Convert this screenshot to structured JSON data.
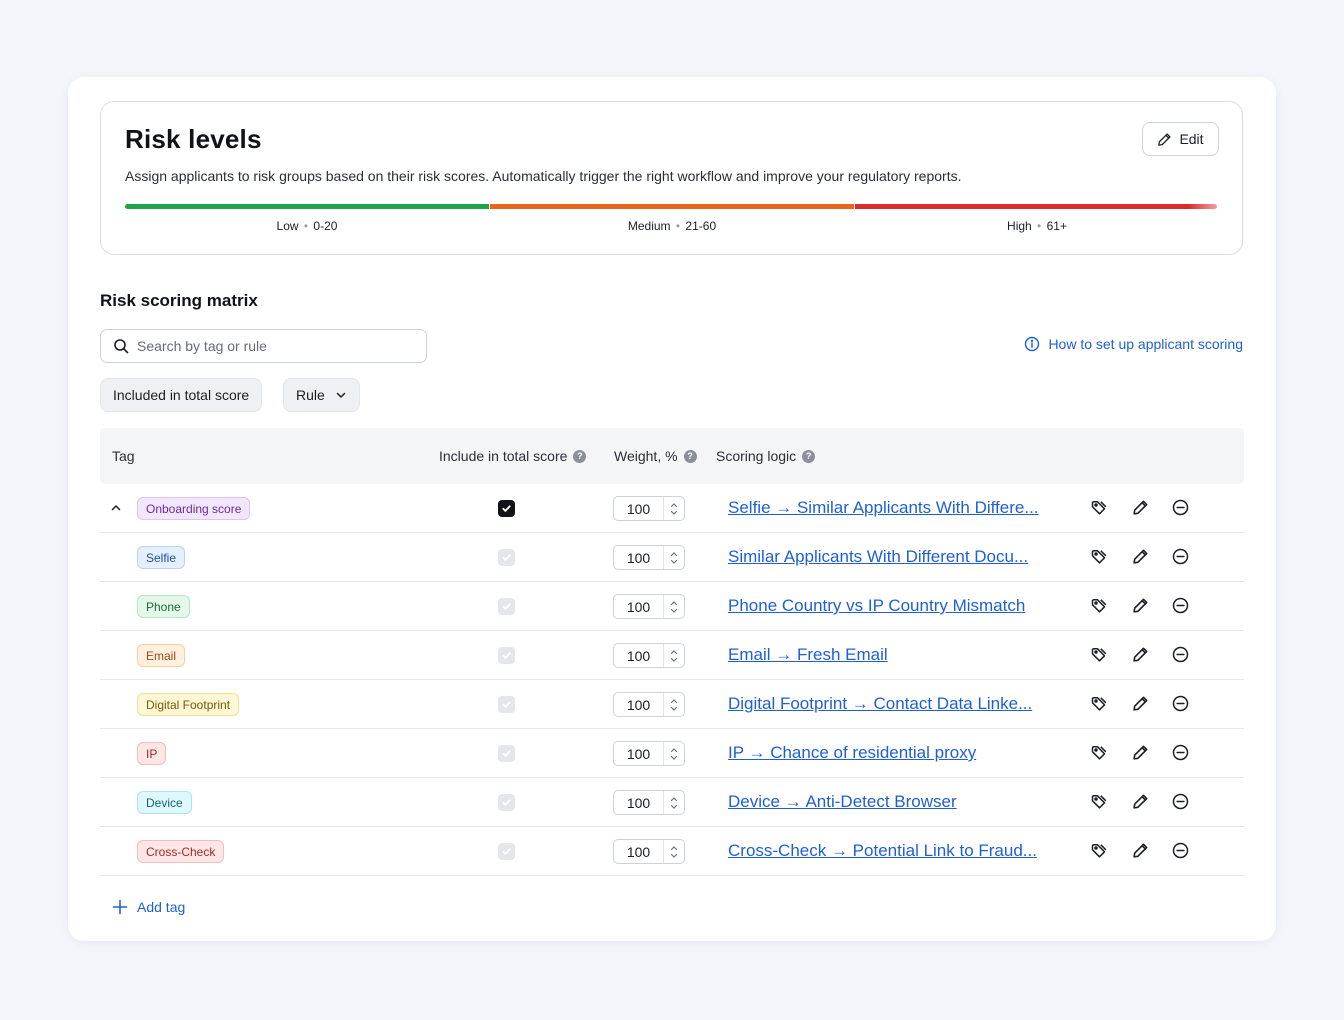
{
  "risk_levels": {
    "title": "Risk levels",
    "description": "Assign applicants to risk groups based on their risk scores. Automatically trigger the right workflow and improve your regulatory reports.",
    "edit_label": "Edit",
    "levels": [
      {
        "name": "Low",
        "range": "0-20",
        "color": "#1fa34a"
      },
      {
        "name": "Medium",
        "range": "21-60",
        "color": "#e9661c"
      },
      {
        "name": "High",
        "range": "61+",
        "color": "#db2b2b"
      }
    ]
  },
  "matrix": {
    "title": "Risk scoring matrix",
    "search_placeholder": "Search by tag or rule",
    "help_link": "How to set up applicant scoring",
    "filters": [
      "Included in total score",
      "Rule"
    ],
    "columns": [
      "Tag",
      "Include in total score",
      "Weight, %",
      "Scoring logic"
    ],
    "rows": [
      {
        "tag": "Onboarding score",
        "included": true,
        "weight": "100",
        "logic": "Selfie → Similar Applicants With Differe...",
        "tag_bg": "#f2e6fb",
        "tag_border": "#ddc2f2",
        "tag_color": "#6b2a9c"
      },
      {
        "tag": "Selfie",
        "included": true,
        "weight": "100",
        "logic": "Similar Applicants With Different Docu...",
        "tag_bg": "#e4efff",
        "tag_border": "#b9d3f8",
        "tag_color": "#1d4f9a"
      },
      {
        "tag": "Phone",
        "included": true,
        "weight": "100",
        "logic": "Phone Country vs IP Country Mismatch",
        "tag_bg": "#e4f8ea",
        "tag_border": "#b4e6c3",
        "tag_color": "#1c6b36"
      },
      {
        "tag": "Email",
        "included": true,
        "weight": "100",
        "logic": "Email → Fresh Email",
        "tag_bg": "#fff0df",
        "tag_border": "#f6cfa0",
        "tag_color": "#9a4a0f"
      },
      {
        "tag": "Digital Footprint",
        "included": true,
        "weight": "100",
        "logic": "Digital Footprint → Contact Data Linke...",
        "tag_bg": "#fff6d6",
        "tag_border": "#f2df92",
        "tag_color": "#7a5a05"
      },
      {
        "tag": "IP",
        "included": true,
        "weight": "100",
        "logic": "IP → Chance of residential proxy",
        "tag_bg": "#fde6e6",
        "tag_border": "#f4bcbc",
        "tag_color": "#a3282a"
      },
      {
        "tag": "Device",
        "included": true,
        "weight": "100",
        "logic": "Device → Anti-Detect Browser",
        "tag_bg": "#dff8fb",
        "tag_border": "#a9e6ee",
        "tag_color": "#13646f"
      },
      {
        "tag": "Cross-Check",
        "included": true,
        "weight": "100",
        "logic": "Cross-Check → Potential Link to Fraud...",
        "tag_bg": "#fde6e6",
        "tag_border": "#f4bcbc",
        "tag_color": "#a3282a"
      }
    ],
    "add_tag_label": "Add tag"
  },
  "icons": {
    "search": "search-icon",
    "info": "info-circle-icon",
    "edit": "pencil-icon",
    "chevron": "chevron-down-icon",
    "collapse": "chevron-up-icon",
    "tag_action": "tag-icon",
    "remove": "minus-circle-icon",
    "add": "plus-icon"
  }
}
